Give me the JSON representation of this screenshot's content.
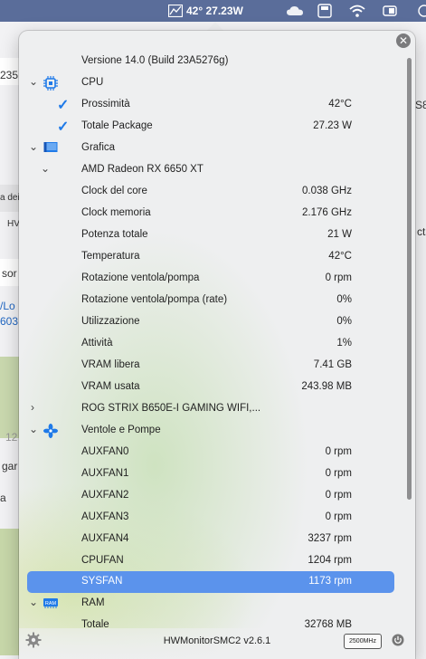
{
  "menubar": {
    "hw_label": "42° 27.23W"
  },
  "background": {
    "frag1": "235",
    "frag2": "S8",
    "frag3": "a dei",
    "frag4": "HV",
    "frag5": "cts",
    "frag6": "sor",
    "frag7": "/Lo",
    "frag8": "603",
    "frag9": "12",
    "frag10": "gar",
    "frag11": "a"
  },
  "popover": {
    "version": "Versione 14.0 (Build 23A5276g)",
    "rows": [
      {
        "label": "CPU",
        "value": ""
      },
      {
        "label": "Prossimità",
        "value": "42°C"
      },
      {
        "label": "Totale Package",
        "value": "27.23 W"
      },
      {
        "label": "Grafica",
        "value": ""
      },
      {
        "label": "AMD Radeon RX 6650 XT",
        "value": ""
      },
      {
        "label": "Clock del core",
        "value": "0.038 GHz"
      },
      {
        "label": "Clock memoria",
        "value": "2.176 GHz"
      },
      {
        "label": "Potenza totale",
        "value": "21 W"
      },
      {
        "label": "Temperatura",
        "value": "42°C"
      },
      {
        "label": "Rotazione ventola/pompa",
        "value": "0 rpm"
      },
      {
        "label": "Rotazione ventola/pompa (rate)",
        "value": "0%"
      },
      {
        "label": "Utilizzazione",
        "value": "0%"
      },
      {
        "label": "Attività",
        "value": "1%"
      },
      {
        "label": "VRAM libera",
        "value": "7.41 GB"
      },
      {
        "label": "VRAM usata",
        "value": "243.98 MB"
      },
      {
        "label": "ROG STRIX B650E-I GAMING WIFI,...",
        "value": ""
      },
      {
        "label": "Ventole e Pompe",
        "value": ""
      },
      {
        "label": "AUXFAN0",
        "value": "0 rpm"
      },
      {
        "label": "AUXFAN1",
        "value": "0 rpm"
      },
      {
        "label": "AUXFAN2",
        "value": "0 rpm"
      },
      {
        "label": "AUXFAN3",
        "value": "0 rpm"
      },
      {
        "label": "AUXFAN4",
        "value": "3237 rpm"
      },
      {
        "label": "CPUFAN",
        "value": "1204 rpm"
      },
      {
        "label": "SYSFAN",
        "value": "1173 rpm"
      },
      {
        "label": "RAM",
        "value": ""
      },
      {
        "label": "Totale",
        "value": "32768 MB"
      }
    ],
    "ram_badge": "RAM",
    "footer_title": "HWMonitorSMC2 v2.6.1",
    "mhz_badge": "2500MHz"
  },
  "colors": {
    "selection": "#5b93ec",
    "check": "#1f7ae8",
    "menubar": "#5a6d9a"
  }
}
